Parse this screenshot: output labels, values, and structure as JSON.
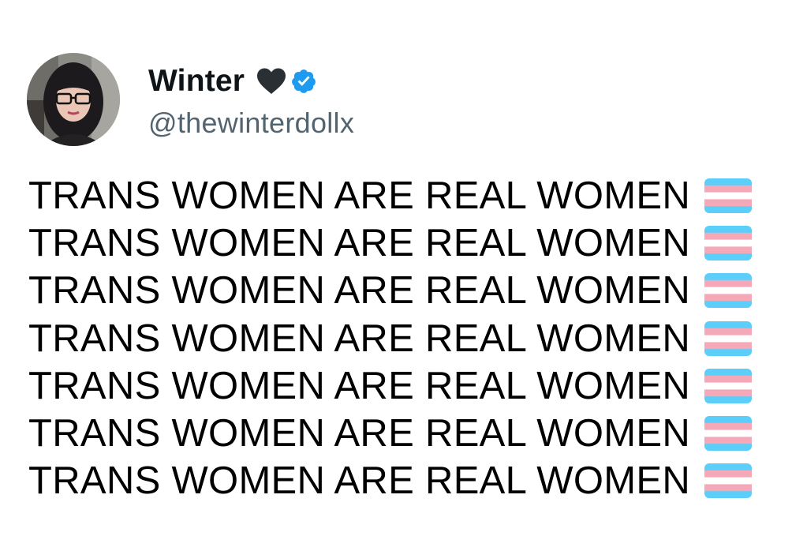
{
  "author": {
    "display_name": "Winter",
    "handle": "@thewinterdollx",
    "name_emoji": "black-heart-icon",
    "verified_badge": "verified-icon",
    "avatar": "profile-photo"
  },
  "tweet": {
    "lines": [
      {
        "text": "TRANS WOMEN ARE REAL WOMEN",
        "emoji": "transgender-flag-icon"
      },
      {
        "text": "TRANS WOMEN ARE REAL WOMEN",
        "emoji": "transgender-flag-icon"
      },
      {
        "text": "TRANS WOMEN ARE REAL WOMEN",
        "emoji": "transgender-flag-icon"
      },
      {
        "text": "TRANS WOMEN ARE REAL WOMEN",
        "emoji": "transgender-flag-icon"
      },
      {
        "text": "TRANS WOMEN ARE REAL WOMEN",
        "emoji": "transgender-flag-icon"
      },
      {
        "text": "TRANS WOMEN ARE REAL WOMEN",
        "emoji": "transgender-flag-icon"
      },
      {
        "text": "TRANS WOMEN ARE REAL WOMEN",
        "emoji": "transgender-flag-icon"
      }
    ]
  },
  "colors": {
    "background": "#ffffff",
    "text_primary": "#0f1419",
    "text_secondary": "#536471",
    "verified_blue": "#1d9bf0",
    "heart": "#292f33",
    "flag_blue": "#5bcefa",
    "flag_pink": "#f5a9b8",
    "flag_white": "#ffffff"
  }
}
